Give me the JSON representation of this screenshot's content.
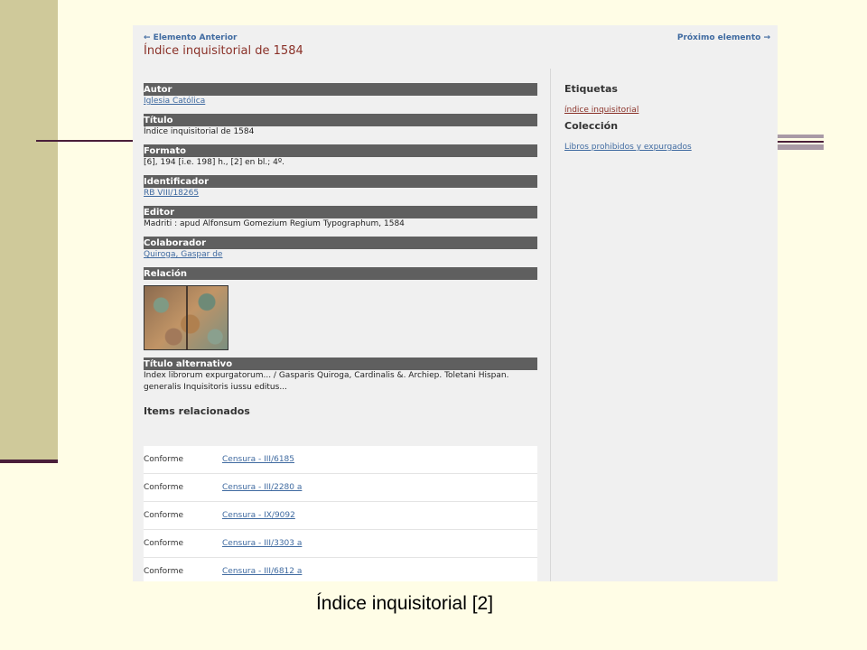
{
  "nav": {
    "prev_label": "← Elemento Anterior",
    "next_label": "Próximo elemento →"
  },
  "page_title": "Índice inquisitorial de 1584",
  "fields": [
    {
      "label": "Autor",
      "value": "Iglesia Católica",
      "link": true
    },
    {
      "label": "Título",
      "value": "Índice inquisitorial de 1584",
      "link": false
    },
    {
      "label": "Formato",
      "value": "[6], 194 [i.e. 198] h., [2] en bl.; 4º.",
      "link": false
    },
    {
      "label": "Identificador",
      "value": "RB VIII/18265",
      "link": true
    },
    {
      "label": "Editor",
      "value": "Madriti : apud Alfonsum Gomezium Regium Typographum, 1584",
      "link": false
    },
    {
      "label": "Colaborador",
      "value": "Quiroga, Gaspar de",
      "link": true
    }
  ],
  "relation": {
    "label": "Relación"
  },
  "alt_title": {
    "label": "Título alternativo",
    "value": "Index librorum expurgatorum... / Gasparis Quiroga, Cardinalis &. Archiep. Toletani Hispan. generalis Inquisitoris iussu editus..."
  },
  "items_title": "Items relacionados",
  "related_items": [
    {
      "type": "Conforme",
      "target": "Censura - III/6185"
    },
    {
      "type": "Conforme",
      "target": "Censura - III/2280 a"
    },
    {
      "type": "Conforme",
      "target": "Censura - IX/9092"
    },
    {
      "type": "Conforme",
      "target": "Censura - III/3303 a"
    },
    {
      "type": "Conforme",
      "target": "Censura - III/6812 a"
    }
  ],
  "sidebar": {
    "tags_heading": "Etiquetas",
    "tag": "índice inquisitorial",
    "collection_heading": "Colección",
    "collection": "Libros prohibidos y expurgados"
  },
  "caption": "Índice inquisitorial [2]"
}
